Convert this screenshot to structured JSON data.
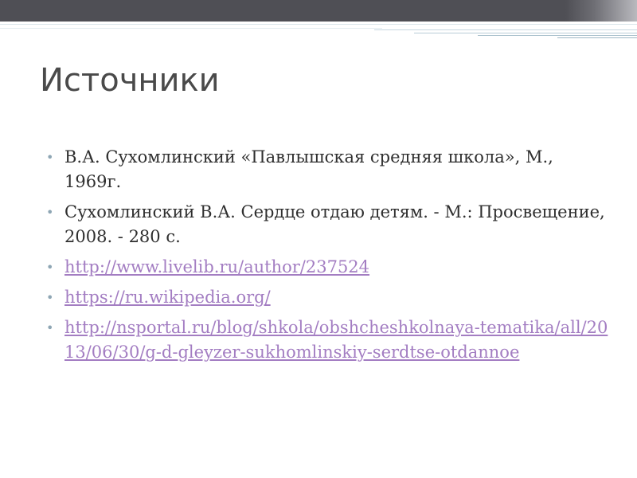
{
  "slide": {
    "title": "Источники",
    "bullet_glyph": "•",
    "items": [
      {
        "text": "В.А. Сухомлинский «Павлышская средняя школа», М., 1969г.",
        "is_link": false
      },
      {
        "text": "Сухомлинский В.А. Сердце отдаю детям. - М.: Просвещение, 2008. - 280 с.",
        "is_link": false
      },
      {
        "text": "http://www.livelib.ru/author/237524",
        "is_link": true
      },
      {
        "text": "https://ru.wikipedia.org/",
        "is_link": true
      },
      {
        "text": "http://nsportal.ru/blog/shkola/obshcheshkolnaya-tematika/all/2013/06/30/g-d-gleyzer-sukhomlinskiy-serdtse-otdannoe",
        "is_link": true
      }
    ]
  },
  "theme": {
    "title_color": "#4a4a4a",
    "text_color": "#2f2f2f",
    "link_color": "#a37dc2",
    "bullet_color": "#8ea6b4",
    "top_bar_color": "#4f4f55",
    "accent_line_colors": [
      "#d6e3ea",
      "#c3d4de",
      "#b5c9d4",
      "#e5edf1"
    ]
  }
}
